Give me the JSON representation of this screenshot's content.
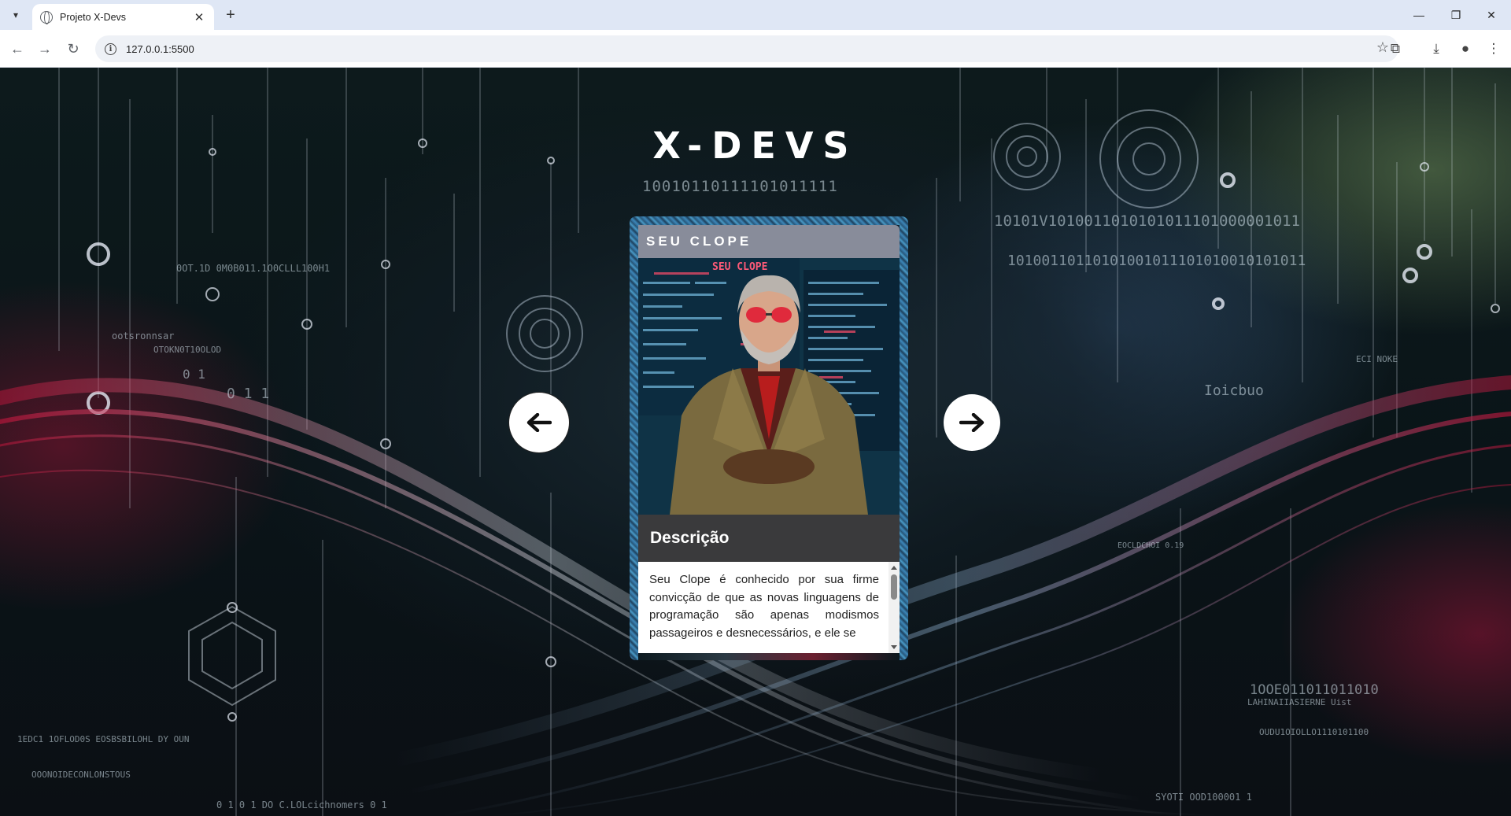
{
  "browser": {
    "tab_title": "Projeto X-Devs",
    "url": "127.0.0.1:5500"
  },
  "page": {
    "title": "X-DEVS",
    "binary_decor": [
      "10010110111101011111",
      "10101V1010011010101011101000001011",
      "10100110110101001011101010010101011",
      "0OT.1D  0M0B011.1O0CLLL100H1",
      "ootsronnsar",
      "OTOKN0T10OLOD",
      "0 1 1",
      "0 1",
      "1EDC1 1OFLOD0S EOSBSBILOHL DY OUN",
      "OOONOIDECONLONSTOUS",
      "0 1 0 1  DO C.LOLcichnomers  0 1",
      "ECI NOKE",
      "Ioicbuo",
      "1OOE011011011010",
      "LAHINAIIASIERNE Uist",
      "OUDU1OIOLLO1110101100",
      "SYOTI  OOD100001 1",
      "EOCLDCHOI 0.19"
    ]
  },
  "carousel": {
    "prev_icon": "arrow-left-icon",
    "next_icon": "arrow-right-icon",
    "card": {
      "name": "SEU CLOPE",
      "screen_label": "SEU CLOPE",
      "description_title": "Descrição",
      "description_text": "Seu Clope é conhecido por sua firme convicção de que as novas linguagens de programação são apenas modismos passageiros e desnecessários, e ele se"
    }
  },
  "colors": {
    "accent_red": "#c0153c",
    "accent_blue": "#3d87b8",
    "card_header_bg": "#3a3a3c"
  }
}
